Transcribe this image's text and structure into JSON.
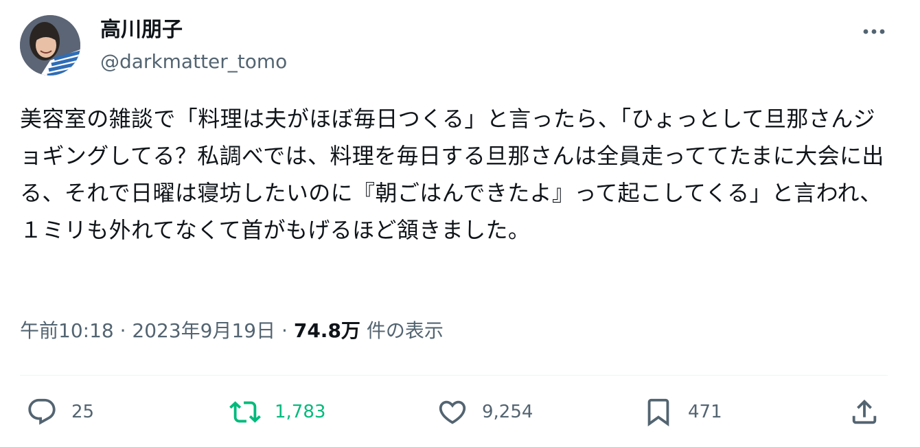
{
  "author": {
    "display_name": "高川朋子",
    "handle": "@darkmatter_tomo"
  },
  "tweet": {
    "text": "美容室の雑談で「料理は夫がほぼ毎日つくる」と言ったら、「ひょっとして旦那さんジョギングしてる？私調べでは、料理を毎日する旦那さんは全員走っててたまに大会に出る、それで日曜は寝坊したいのに『朝ごはんできたよ』って起こしてくる」と言われ、１ミリも外れてなくて首がもげるほど頷きました。"
  },
  "meta": {
    "time": "午前10:18",
    "separator": "·",
    "date": "2023年9月19日",
    "views_count": "74.8万",
    "views_label": "件の表示"
  },
  "actions": {
    "reply": {
      "icon": "reply-bubble-icon",
      "count": "25"
    },
    "retweet": {
      "icon": "retweet-icon",
      "count": "1,783",
      "color": "#00ba7c"
    },
    "like": {
      "icon": "heart-icon",
      "count": "9,254"
    },
    "bookmark": {
      "icon": "bookmark-icon",
      "count": "471"
    },
    "share": {
      "icon": "share-upload-icon"
    }
  },
  "colors": {
    "text_primary": "#0f1419",
    "text_secondary": "#536471",
    "retweet_active": "#00ba7c",
    "divider": "#eff3f4"
  }
}
